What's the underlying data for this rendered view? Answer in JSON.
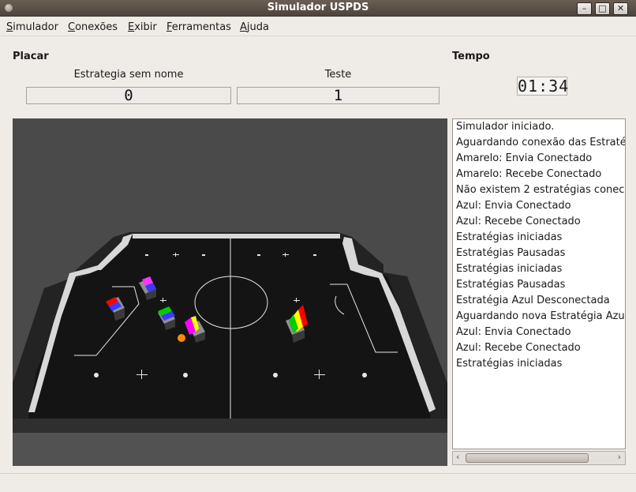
{
  "window": {
    "title": "Simulador USPDS"
  },
  "menu": [
    {
      "first": "S",
      "rest": "imulador"
    },
    {
      "first": "C",
      "rest": "onexões"
    },
    {
      "first": "E",
      "rest": "xibir"
    },
    {
      "first": "F",
      "rest": "erramentas"
    },
    {
      "first": "A",
      "rest": "juda"
    }
  ],
  "scoreboard": {
    "label": "Placar",
    "team_left": {
      "name": "Estrategia sem nome",
      "score": "0"
    },
    "team_right": {
      "name": "Teste",
      "score": "1"
    }
  },
  "time": {
    "label": "Tempo",
    "value": "01:34"
  },
  "field": {
    "robots": [
      {
        "team": "left",
        "colors": [
          "#ff0000",
          "#3a3aff"
        ]
      },
      {
        "team": "left",
        "colors": [
          "#ff33ff",
          "#3a3aff"
        ]
      },
      {
        "team": "left",
        "colors": [
          "#00cc00",
          "#3a3aff"
        ]
      },
      {
        "team": "left",
        "colors": [
          "#ff00ff",
          "#ffff00"
        ]
      },
      {
        "team": "right",
        "colors": [
          "#ff0000",
          "#ffff00"
        ]
      },
      {
        "team": "right",
        "colors": [
          "#00cc00",
          "#ffff00"
        ]
      }
    ],
    "ball_color": "#ff8c00"
  },
  "log": [
    "Simulador iniciado.",
    "Aguardando conexão das Estraté",
    "Amarelo: Envia Conectado",
    "Amarelo: Recebe Conectado",
    "Não existem 2 estratégias conec",
    "Azul: Envia Conectado",
    "Azul: Recebe Conectado",
    "Estratégias iniciadas",
    "Estratégias Pausadas",
    "Estratégias iniciadas",
    "Estratégias Pausadas",
    "Estratégia Azul Desconectada",
    "Aguardando nova Estratégia Azul",
    "Azul: Envia Conectado",
    "Azul: Recebe Conectado",
    "Estratégias iniciadas"
  ],
  "window_buttons": {
    "minimize": "–",
    "maximize": "□",
    "close": "✕"
  },
  "scroll_arrows": {
    "left": "‹",
    "right": "›"
  }
}
